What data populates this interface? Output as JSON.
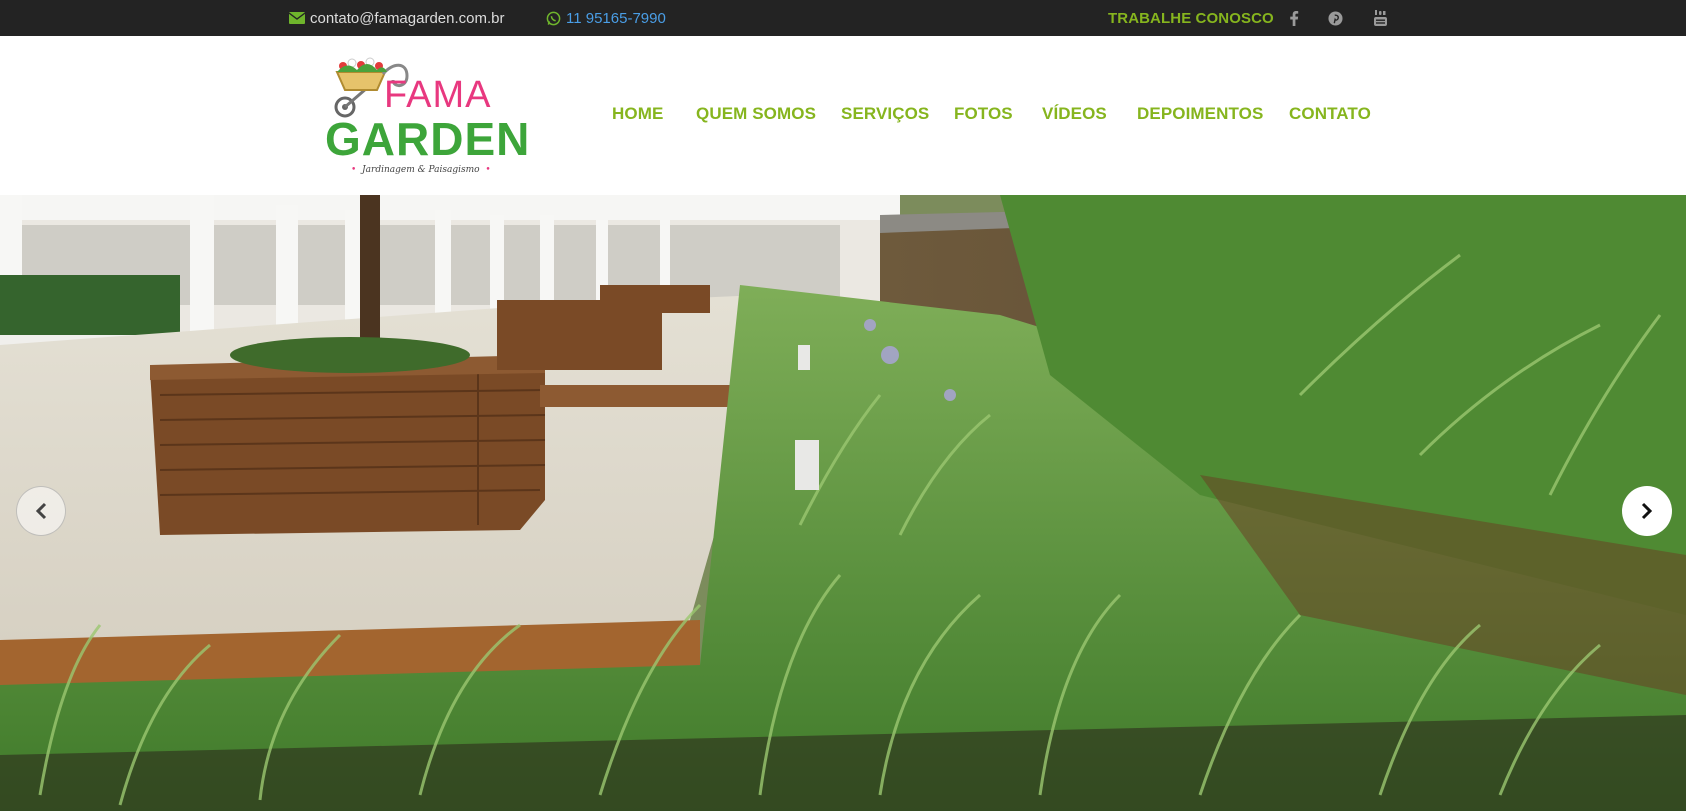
{
  "topbar": {
    "email": "contato@famagarden.com.br",
    "phone": "11 95165-7990",
    "work_with_us": "TRABALHE CONOSCO",
    "social_icons": [
      "facebook-icon",
      "pinterest-icon",
      "youtube-icon"
    ]
  },
  "logo": {
    "word1": "FAMA",
    "word2": "GARDEN",
    "tagline": "Jardinagem & Paisagismo"
  },
  "nav": {
    "items": [
      {
        "label": "HOME"
      },
      {
        "label": "QUEM SOMOS"
      },
      {
        "label": "SERVIÇOS"
      },
      {
        "label": "FOTOS"
      },
      {
        "label": "VÍDEOS"
      },
      {
        "label": "DEPOIMENTOS"
      },
      {
        "label": "CONTATO"
      }
    ]
  },
  "slider": {
    "prev_icon": "chevron-left-icon",
    "next_icon": "chevron-right-icon"
  },
  "colors": {
    "topbar_bg": "#232323",
    "accent_green": "#86b51e",
    "phone_blue": "#4a9ee6",
    "logo_pink": "#e8387f",
    "logo_green": "#3da53a"
  }
}
